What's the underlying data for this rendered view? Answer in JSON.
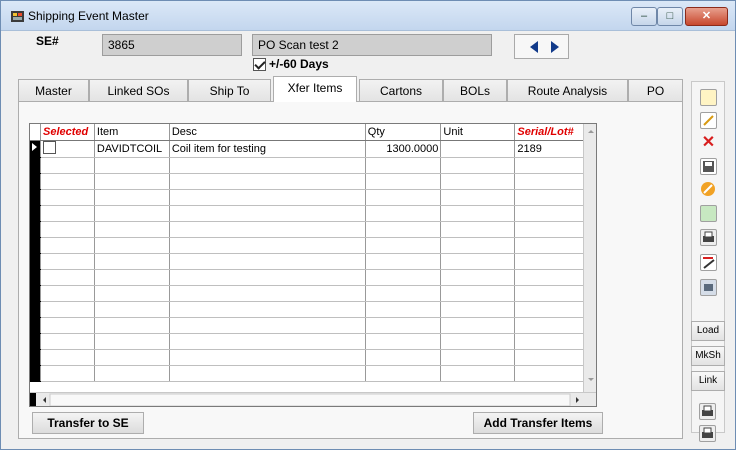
{
  "window": {
    "title": "Shipping Event Master",
    "minimize_glyph": "–",
    "maximize_glyph": "□",
    "close_glyph": "✕"
  },
  "header": {
    "se_label": "SE#",
    "se_number": "3865",
    "se_description": "PO Scan test 2",
    "days_label": "+/-60 Days",
    "days_checked": true
  },
  "tabs": [
    {
      "label": "Master"
    },
    {
      "label": "Linked SOs"
    },
    {
      "label": "Ship To"
    },
    {
      "label": "Xfer Items",
      "active": true
    },
    {
      "label": "Cartons"
    },
    {
      "label": "BOLs"
    },
    {
      "label": "Route Analysis"
    },
    {
      "label": "PO"
    }
  ],
  "grid": {
    "columns": [
      "Selected",
      "Item",
      "Desc",
      "Qty",
      "Unit",
      "Serial/Lot#"
    ],
    "required_columns": [
      "Selected",
      "Serial/Lot#"
    ],
    "rows": [
      {
        "selected": false,
        "item": "DAVIDTCOIL",
        "desc": "Coil item for testing",
        "qty": "1300.0000",
        "unit": "",
        "serial": "2189"
      }
    ]
  },
  "buttons": {
    "transfer": "Transfer to SE",
    "add_transfer": "Add Transfer Items"
  },
  "toolbar": {
    "icons": [
      "new-icon",
      "edit-icon",
      "delete-icon",
      "save-icon",
      "cancel-icon",
      "copy-icon",
      "print-icon",
      "report-icon",
      "scan-icon"
    ],
    "load": "Load",
    "mksh": "MkSh",
    "link": "Link"
  },
  "colors": {
    "required_header": "#e00000",
    "title_bar": "#c3d6ee",
    "nav_arrow": "#113a8a"
  }
}
